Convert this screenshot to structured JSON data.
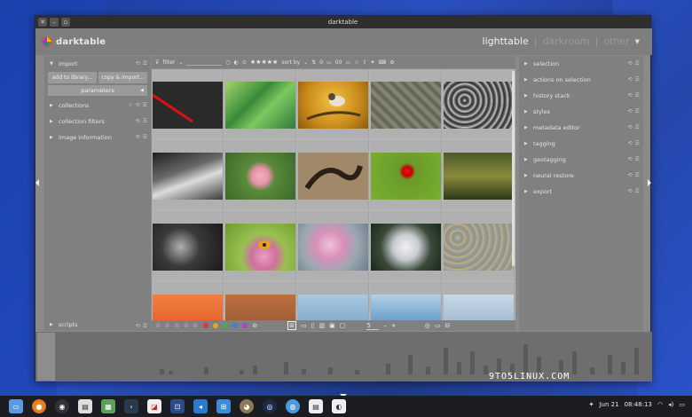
{
  "window": {
    "title": "darktable"
  },
  "header": {
    "app_name": "darktable",
    "views": [
      {
        "label": "lighttable",
        "active": true
      },
      {
        "label": "darkroom",
        "active": false
      },
      {
        "label": "other",
        "active": false
      }
    ]
  },
  "left_panel": {
    "import": {
      "label": "import",
      "buttons": [
        "add to library...",
        "copy & import..."
      ],
      "parameters_label": "parameters"
    },
    "modules": [
      "collections",
      "collection filters",
      "image information"
    ],
    "scripts_label": "scripts"
  },
  "right_panel": {
    "modules": [
      "selection",
      "actions on selection",
      "history stack",
      "styles",
      "metadata editor",
      "tagging",
      "geotagging",
      "neural restore",
      "export"
    ]
  },
  "toolbar": {
    "filter_label": "filter",
    "rating_stars": "★★★★★",
    "sort_label": "sort by",
    "count_value": "0",
    "count_value_2": "00"
  },
  "bottom_bar": {
    "stars": "☆ ☆ ☆ ☆ ☆",
    "zoom_value": "5",
    "color_labels": [
      "#d63b3b",
      "#e3a51c",
      "#3bb34a",
      "#3b7fd6",
      "#b53bd6"
    ]
  },
  "thumbnails": [
    {
      "name": "thumb-red-line",
      "desc": "dark with red diagonal"
    },
    {
      "name": "thumb-green-leaf",
      "desc": "green leaf"
    },
    {
      "name": "thumb-bird",
      "desc": "bird on branch"
    },
    {
      "name": "thumb-rock-texture",
      "desc": "rock texture"
    },
    {
      "name": "thumb-dark-texture",
      "desc": "dark texture"
    },
    {
      "name": "thumb-rocks-coast",
      "desc": "rocky coast"
    },
    {
      "name": "thumb-pink-flower",
      "desc": "pink flower"
    },
    {
      "name": "thumb-snake",
      "desc": "snake"
    },
    {
      "name": "thumb-red-poppy",
      "desc": "red poppy"
    },
    {
      "name": "thumb-pond",
      "desc": "pond"
    },
    {
      "name": "thumb-water-splash",
      "desc": "dark water"
    },
    {
      "name": "thumb-bee-flower",
      "desc": "bee on flower"
    },
    {
      "name": "thumb-pink-blossom",
      "desc": "pink blossom"
    },
    {
      "name": "thumb-bird-white",
      "desc": "white bird"
    },
    {
      "name": "thumb-pebbles",
      "desc": "pebbles"
    },
    {
      "name": "thumb-sunset",
      "desc": "sunset"
    },
    {
      "name": "thumb-sunset-2",
      "desc": "sunset 2"
    },
    {
      "name": "thumb-sea",
      "desc": "sea"
    },
    {
      "name": "thumb-sea-2",
      "desc": "sea 2"
    },
    {
      "name": "thumb-harbor",
      "desc": "harbor"
    }
  ],
  "taskbar": {
    "date": "Jun 21",
    "time": "08:48:13"
  },
  "watermark": {
    "text": "9TO5LINUX.COM"
  }
}
